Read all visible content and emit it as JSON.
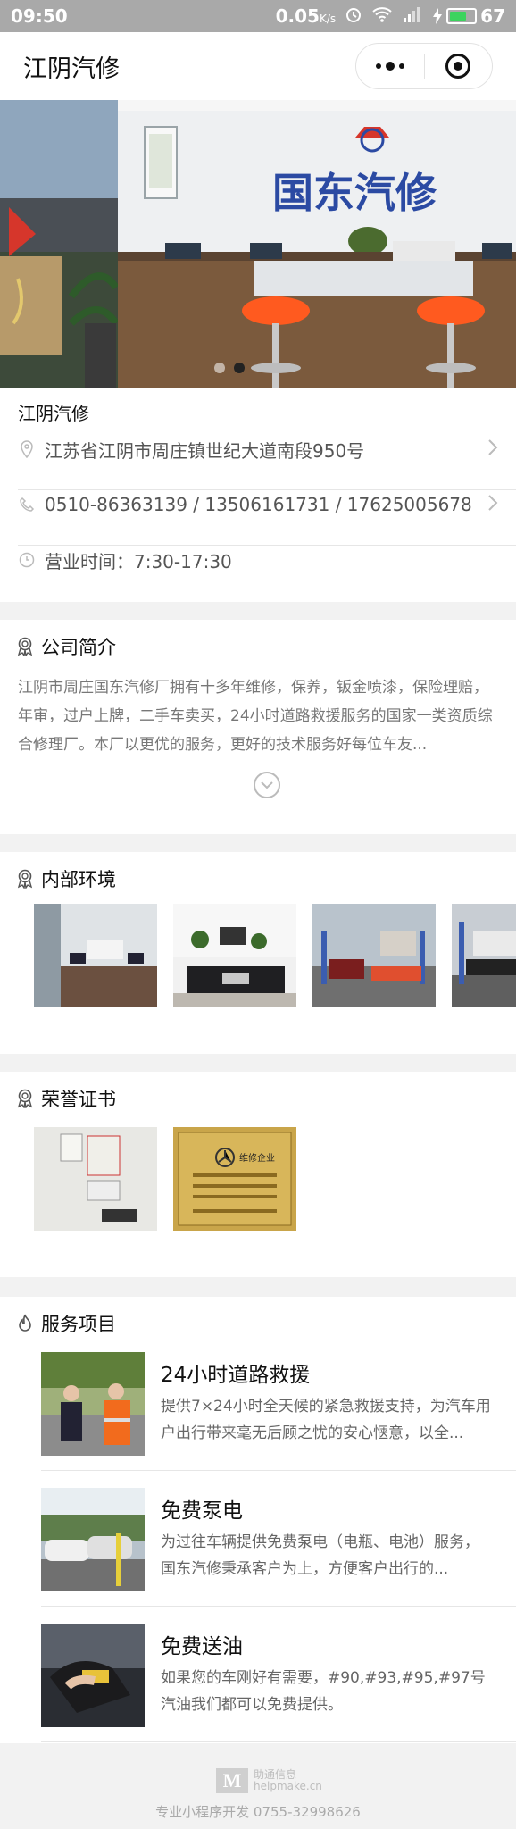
{
  "status_bar": {
    "time": "09:50",
    "speed": "0.05",
    "speed_unit": "K/s",
    "battery": "67",
    "battery_level": 0.67
  },
  "nav": {
    "title": "江阴汽修"
  },
  "banner": {
    "sign_text": "国东汽修",
    "slide_count": 2,
    "active_slide": 2
  },
  "shop": {
    "name": "江阴汽修",
    "address": "江苏省江阴市周庄镇世纪大道南段950号",
    "phone": "0510-86363139 / 13506161731 / 17625005678",
    "hours": "营业时间：7:30-17:30"
  },
  "intro": {
    "heading": "公司简介",
    "text": "江阴市周庄国东汽修厂拥有十多年维修，保养，钣金喷漆，保险理赔，年审，过户上牌，二手车卖买，24小时道路救援服务的国家一类资质综合修理厂。本厂以更优的服务，更好的技术服务好每位车友..."
  },
  "environment": {
    "heading": "内部环境"
  },
  "certificates": {
    "heading": "荣誉证书",
    "plaque_text": "维修企业"
  },
  "services": {
    "heading": "服务项目",
    "items": [
      {
        "title": "24小时道路救援",
        "desc": "提供7×24小时全天候的紧急救援支持，为汽车用户出行带来毫无后顾之忧的安心惬意，以全..."
      },
      {
        "title": "免费泵电",
        "desc": "为过往车辆提供免费泵电（电瓶、电池）服务，国东汽修秉承客户为上，方便客户出行的..."
      },
      {
        "title": "免费送油",
        "desc": "如果您的车刚好有需要，#90,#93,#95,#97号汽油我们都可以免费提供。"
      }
    ]
  },
  "footer": {
    "logo_cn": "助通信息",
    "logo_en": "helpmake.cn",
    "credit": "专业小程序开发  0755-32998626"
  },
  "colors": {
    "status_bar": "#a9a9a9",
    "page_bg": "#f2f2f2",
    "text_muted": "#777777",
    "stool": "#ff5a1f",
    "sign_blue": "#2b4aa3"
  }
}
